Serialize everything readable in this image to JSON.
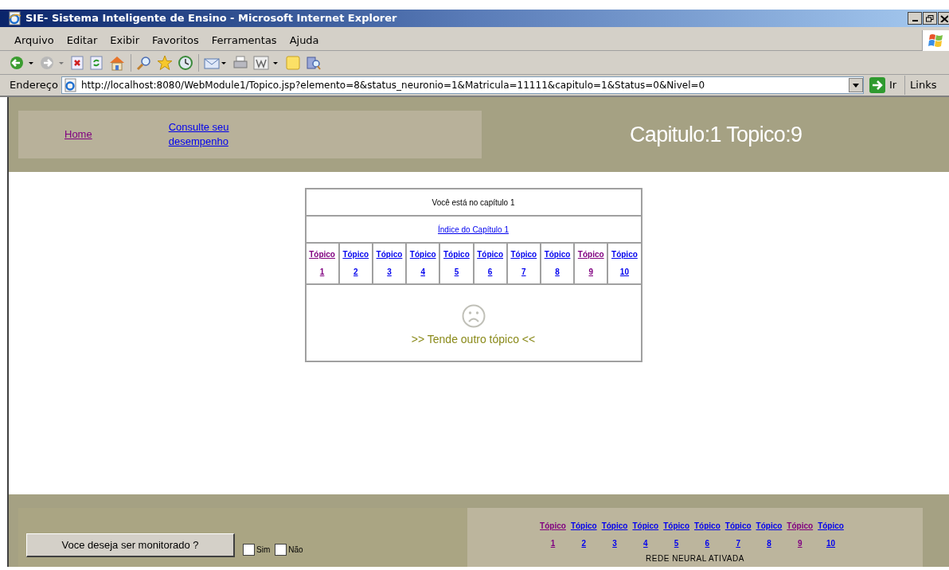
{
  "window": {
    "title": "SIE- Sistema Inteligente de Ensino - Microsoft Internet Explorer"
  },
  "menu": [
    "Arquivo",
    "Editar",
    "Exibir",
    "Favoritos",
    "Ferramentas",
    "Ajuda"
  ],
  "address_bar": {
    "label": "Endereço",
    "value": "http://localhost:8080/WebModule1/Topico.jsp?elemento=8&status_neuronio=1&Matricula=11111&capitulo=1&Status=0&Nivel=0",
    "go": "Ir",
    "links": "Links"
  },
  "header": {
    "links": [
      {
        "text": "Home",
        "visited": true
      },
      {
        "text": "Consulte seu desempenho",
        "visited": false
      }
    ],
    "title": "Capitulo:1 Topico:9"
  },
  "panel": {
    "caption": "Você está no capítulo 1",
    "index_link": "Índice do Capítulo 1",
    "topics": [
      {
        "label": "Tópico",
        "number": "1",
        "visited": true
      },
      {
        "label": "Tópico",
        "number": "2",
        "visited": false
      },
      {
        "label": "Tópico",
        "number": "3",
        "visited": false
      },
      {
        "label": "Tópico",
        "number": "4",
        "visited": false
      },
      {
        "label": "Tópico",
        "number": "5",
        "visited": false
      },
      {
        "label": "Tópico",
        "number": "6",
        "visited": false
      },
      {
        "label": "Tópico",
        "number": "7",
        "visited": false
      },
      {
        "label": "Tópico",
        "number": "8",
        "visited": false
      },
      {
        "label": "Tópico",
        "number": "9",
        "visited": true
      },
      {
        "label": "Tópico",
        "number": "10",
        "visited": false
      }
    ],
    "message": ">> Tende outro tópico <<"
  },
  "footer": {
    "monitor_button": "Voce deseja ser monitorado ?",
    "options": [
      {
        "label": "Sim",
        "checked": false
      },
      {
        "label": "Não",
        "checked": false
      }
    ],
    "topics": [
      {
        "label": "Tópico",
        "number": "1",
        "visited": true
      },
      {
        "label": "Tópico",
        "number": "2",
        "visited": false
      },
      {
        "label": "Tópico",
        "number": "3",
        "visited": false
      },
      {
        "label": "Tópico",
        "number": "4",
        "visited": false
      },
      {
        "label": "Tópico",
        "number": "5",
        "visited": false
      },
      {
        "label": "Tópico",
        "number": "6",
        "visited": false
      },
      {
        "label": "Tópico",
        "number": "7",
        "visited": false
      },
      {
        "label": "Tópico",
        "number": "8",
        "visited": false
      },
      {
        "label": "Tópico",
        "number": "9",
        "visited": true
      },
      {
        "label": "Tópico",
        "number": "10",
        "visited": false
      }
    ],
    "status": "REDE NEURAL ATIVADA"
  }
}
